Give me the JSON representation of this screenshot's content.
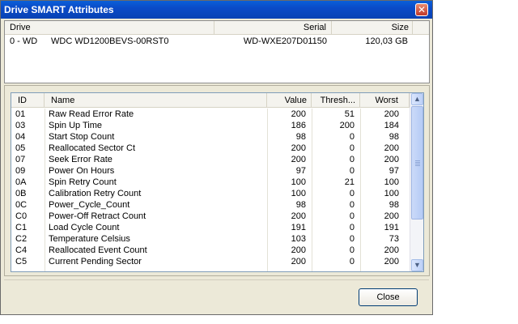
{
  "window": {
    "title": "Drive SMART Attributes",
    "close_glyph": "✕"
  },
  "drives": {
    "headers": {
      "drive": "Drive",
      "serial": "Serial",
      "size": "Size"
    },
    "rows": [
      {
        "drive": "0 - WD",
        "model": "WDC WD1200BEVS-00RST0",
        "serial": "WD-WXE207D01150",
        "size": "120,03 GB"
      }
    ]
  },
  "attributes": {
    "headers": {
      "id": "ID",
      "name": "Name",
      "value": "Value",
      "thresh": "Thresh...",
      "worst": "Worst"
    },
    "rows": [
      {
        "id": "01",
        "name": "Raw Read Error Rate",
        "value": "200",
        "thresh": "51",
        "worst": "200"
      },
      {
        "id": "03",
        "name": "Spin Up Time",
        "value": "186",
        "thresh": "200",
        "worst": "184"
      },
      {
        "id": "04",
        "name": "Start Stop Count",
        "value": "98",
        "thresh": "0",
        "worst": "98"
      },
      {
        "id": "05",
        "name": "Reallocated Sector Ct",
        "value": "200",
        "thresh": "0",
        "worst": "200"
      },
      {
        "id": "07",
        "name": "Seek Error Rate",
        "value": "200",
        "thresh": "0",
        "worst": "200"
      },
      {
        "id": "09",
        "name": "Power On Hours",
        "value": "97",
        "thresh": "0",
        "worst": "97"
      },
      {
        "id": "0A",
        "name": "Spin Retry Count",
        "value": "100",
        "thresh": "21",
        "worst": "100"
      },
      {
        "id": "0B",
        "name": "Calibration Retry Count",
        "value": "100",
        "thresh": "0",
        "worst": "100"
      },
      {
        "id": "0C",
        "name": "Power_Cycle_Count",
        "value": "98",
        "thresh": "0",
        "worst": "98"
      },
      {
        "id": "C0",
        "name": "Power-Off Retract Count",
        "value": "200",
        "thresh": "0",
        "worst": "200"
      },
      {
        "id": "C1",
        "name": "Load Cycle Count",
        "value": "191",
        "thresh": "0",
        "worst": "191"
      },
      {
        "id": "C2",
        "name": "Temperature Celsius",
        "value": "103",
        "thresh": "0",
        "worst": "73"
      },
      {
        "id": "C4",
        "name": "Reallocated Event Count",
        "value": "200",
        "thresh": "0",
        "worst": "200"
      },
      {
        "id": "C5",
        "name": "Current Pending Sector",
        "value": "200",
        "thresh": "0",
        "worst": "200"
      }
    ],
    "scroll": {
      "up_glyph": "▲",
      "down_glyph": "▼"
    }
  },
  "footer": {
    "close_label": "Close"
  }
}
